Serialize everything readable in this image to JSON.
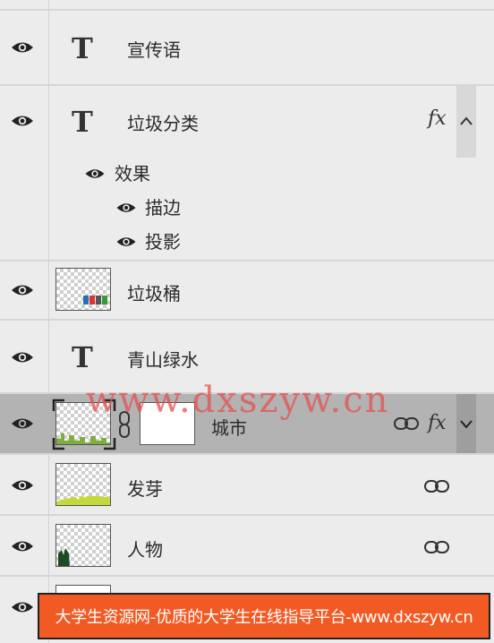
{
  "layers": [
    {
      "name": "宣传语",
      "kind": "text"
    },
    {
      "name": "垃圾分类",
      "kind": "text",
      "fx": "fx",
      "effects_label": "效果",
      "effects": [
        "描边",
        "投影"
      ]
    },
    {
      "name": "垃圾桶",
      "kind": "image"
    },
    {
      "name": "青山绿水",
      "kind": "text"
    },
    {
      "name": "城市",
      "kind": "image-mask",
      "fx": "fx",
      "selected": true
    },
    {
      "name": "发芽",
      "kind": "image"
    },
    {
      "name": "人物",
      "kind": "image"
    }
  ],
  "watermark": "www.dxszyw.cn",
  "banner": "大学生资源网-优质的大学生在线指导平台-www.dxszyw.cn",
  "colors": {
    "selected_row": "#b3b3b3",
    "banner": "#f25a24",
    "watermark": "#e65050"
  }
}
